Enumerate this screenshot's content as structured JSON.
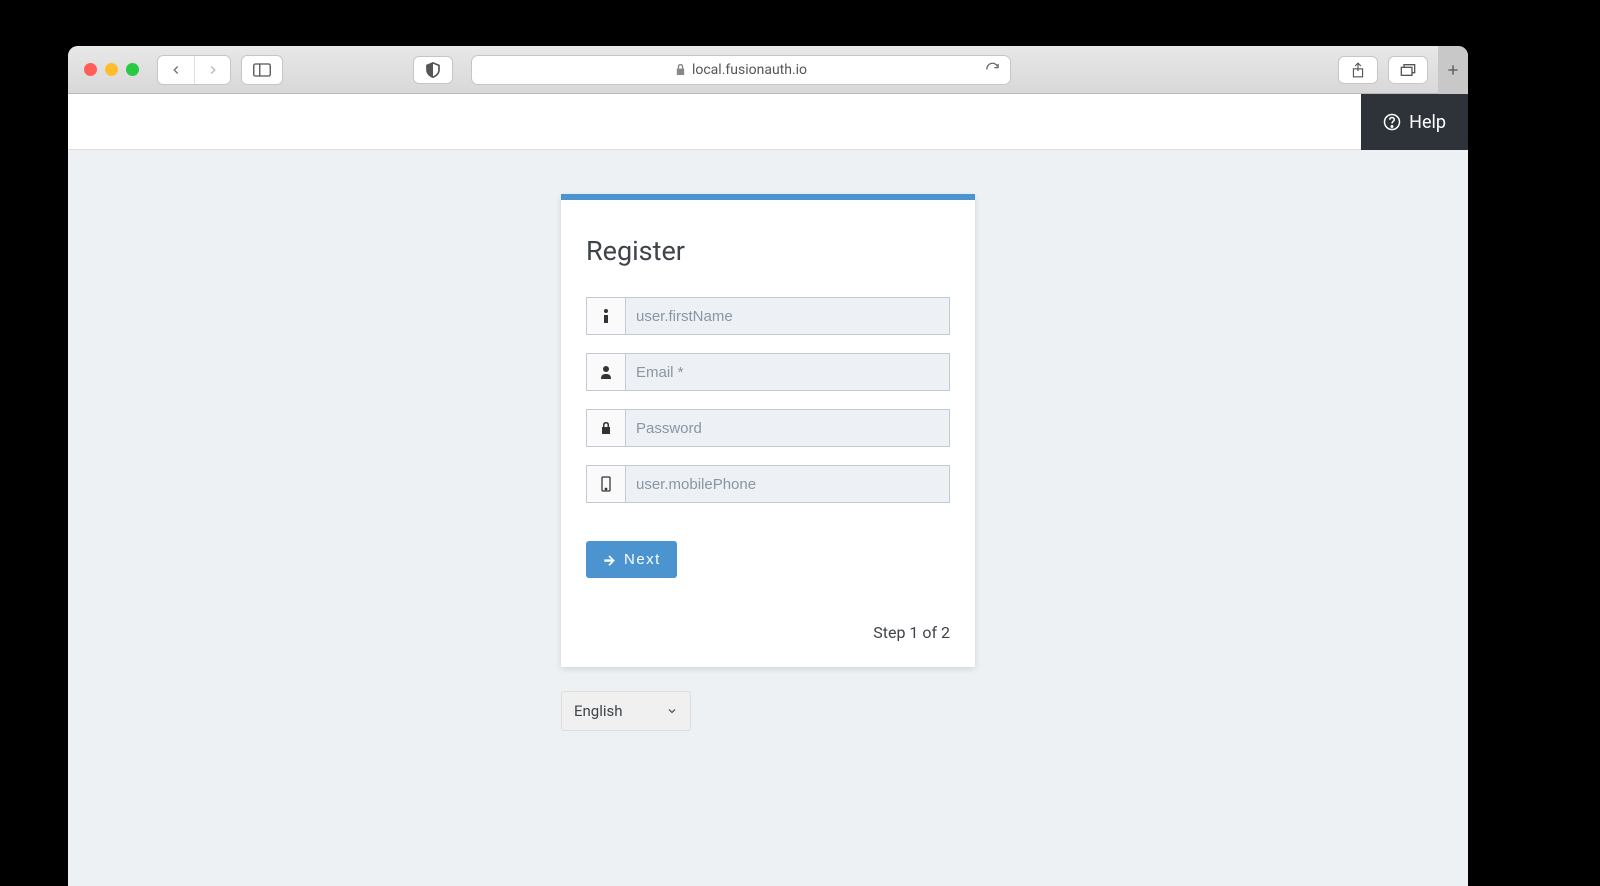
{
  "browser": {
    "url": "local.fusionauth.io"
  },
  "header": {
    "help_label": "Help"
  },
  "card": {
    "title": "Register",
    "fields": {
      "firstName": {
        "placeholder": "user.firstName"
      },
      "email": {
        "placeholder": "Email *"
      },
      "password": {
        "placeholder": "Password"
      },
      "mobilePhone": {
        "placeholder": "user.mobilePhone"
      }
    },
    "next_label": "Next",
    "step_text": "Step 1 of 2"
  },
  "language": {
    "selected": "English"
  }
}
